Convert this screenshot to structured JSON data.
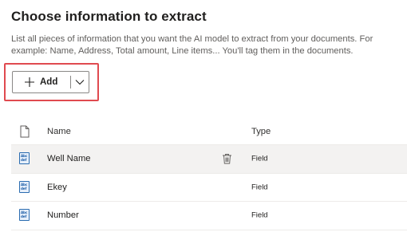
{
  "header": {
    "title": "Choose information to extract",
    "description": "List all pieces of information that you want the AI model to extract from your documents. For example: Name, Address, Total amount, Line items... You'll tag them in the documents."
  },
  "toolbar": {
    "add_label": "Add",
    "add_icon": "plus-icon",
    "dropdown_icon": "chevron-down-icon",
    "highlight_color": "#e04a4f"
  },
  "table": {
    "columns": {
      "icon": "document-icon",
      "name": "Name",
      "type": "Type"
    },
    "rows": [
      {
        "name": "Well Name",
        "type": "Field",
        "icon_text_1": "Abc",
        "icon_text_2": "def",
        "selected": true
      },
      {
        "name": "Ekey",
        "type": "Field",
        "icon_text_1": "Abc",
        "icon_text_2": "def",
        "selected": false
      },
      {
        "name": "Number",
        "type": "Field",
        "icon_text_1": "Abc",
        "icon_text_2": "def",
        "selected": false
      }
    ]
  }
}
